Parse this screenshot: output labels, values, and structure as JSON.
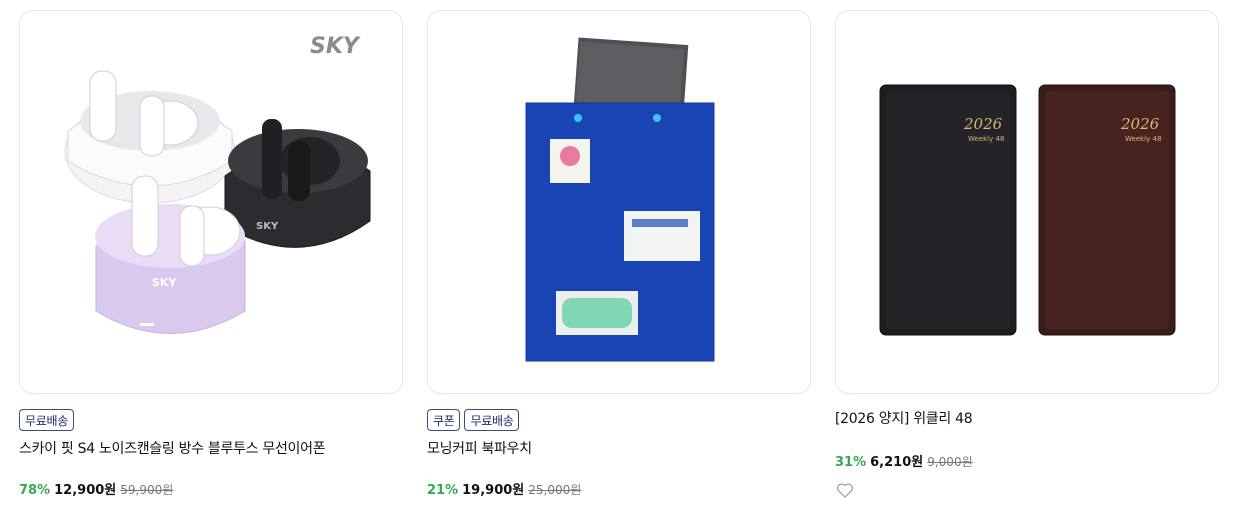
{
  "products": [
    {
      "image_desc": "earbuds",
      "brand_mark": "SKY",
      "badges": [
        "무료배송"
      ],
      "title": "스카이 핏 S4 노이즈캔슬링 방수 블루투스 무선이어폰",
      "discount": "78%",
      "price": "12,900원",
      "original_price": "59,900원"
    },
    {
      "image_desc": "book-pouch",
      "badges": [
        "쿠폰",
        "무료배송"
      ],
      "title": "모닝커피 북파우치",
      "discount": "21%",
      "price": "19,900원",
      "original_price": "25,000원"
    },
    {
      "image_desc": "planners",
      "planner_year": "2026",
      "planner_sub": "Weekly 48",
      "badges": [],
      "title": "[2026 양지] 위클리 48",
      "discount": "31%",
      "price": "6,210원",
      "original_price": "9,000원",
      "wishlist_icon": "heart-outline-icon"
    }
  ],
  "colors": {
    "discount": "#34a853",
    "badge_border": "#3b4a85",
    "card_border": "#e6e6e6",
    "pouch_blue": "#1a47b8"
  }
}
